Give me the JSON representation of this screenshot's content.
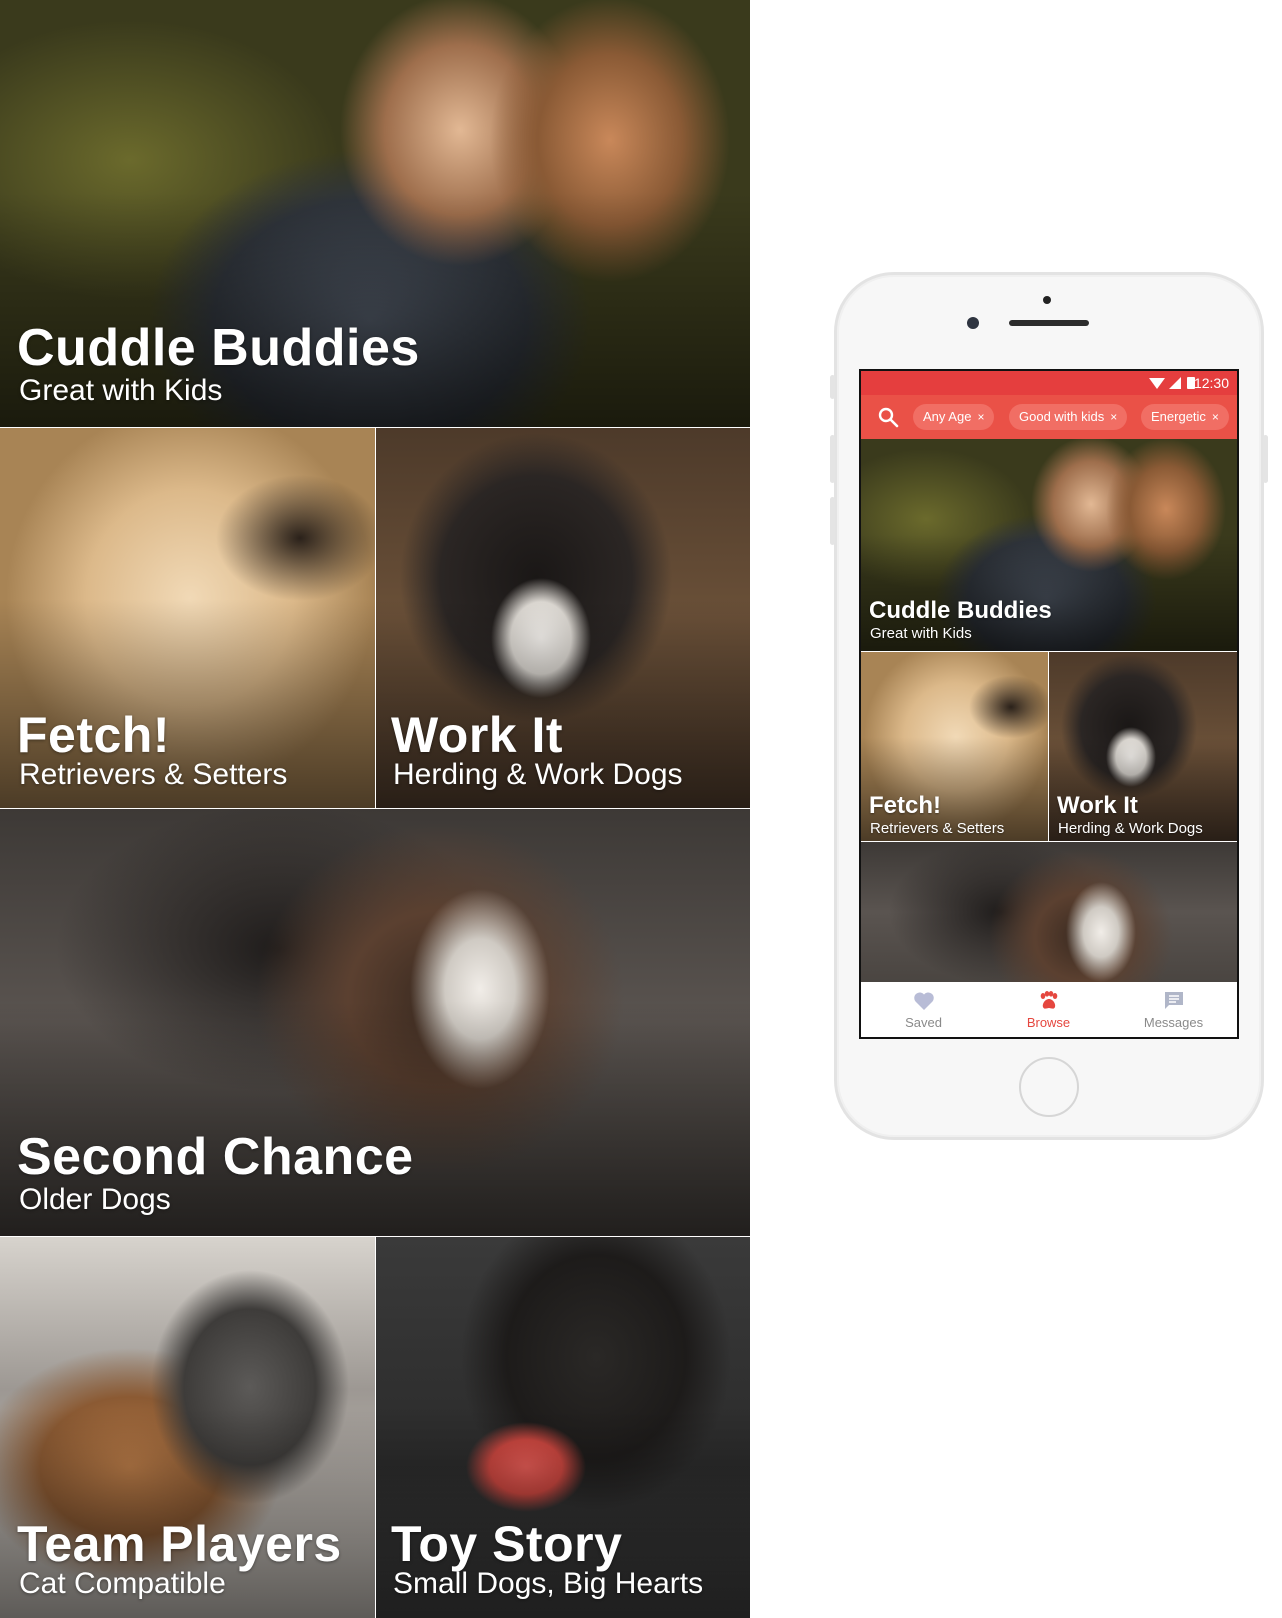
{
  "board": {
    "tiles": [
      {
        "title": "Cuddle Buddies",
        "subtitle": "Great with Kids"
      },
      {
        "title": "Fetch!",
        "subtitle": "Retrievers & Setters"
      },
      {
        "title": "Work It",
        "subtitle": "Herding & Work Dogs"
      },
      {
        "title": "Second Chance",
        "subtitle": "Older Dogs"
      },
      {
        "title": "Team Players",
        "subtitle": "Cat Compatible"
      },
      {
        "title": "Toy Story",
        "subtitle": "Small Dogs, Big Hearts"
      }
    ]
  },
  "phone": {
    "status_bar": {
      "time": "12:30",
      "icons": [
        "wifi-icon",
        "signal-icon",
        "battery-icon"
      ],
      "color": "#e53e3e"
    },
    "filter_bar": {
      "color": "#ea5147",
      "search_icon": "search-icon",
      "chips": [
        {
          "label": "Any Age",
          "remove": "×"
        },
        {
          "label": "Good with kids",
          "remove": "×"
        },
        {
          "label": "Energetic",
          "remove": "×"
        }
      ]
    },
    "tiles": [
      {
        "title": "Cuddle Buddies",
        "subtitle": "Great with Kids"
      },
      {
        "title": "Fetch!",
        "subtitle": "Retrievers & Setters"
      },
      {
        "title": "Work It",
        "subtitle": "Herding & Work Dogs"
      }
    ],
    "tab_bar": {
      "accent": "#e5473f",
      "inactive_color": "#8a8a8a",
      "tabs": [
        {
          "label": "Saved",
          "icon": "heart-icon",
          "active": false
        },
        {
          "label": "Browse",
          "icon": "paw-icon",
          "active": true
        },
        {
          "label": "Messages",
          "icon": "message-icon",
          "active": false
        }
      ]
    }
  }
}
